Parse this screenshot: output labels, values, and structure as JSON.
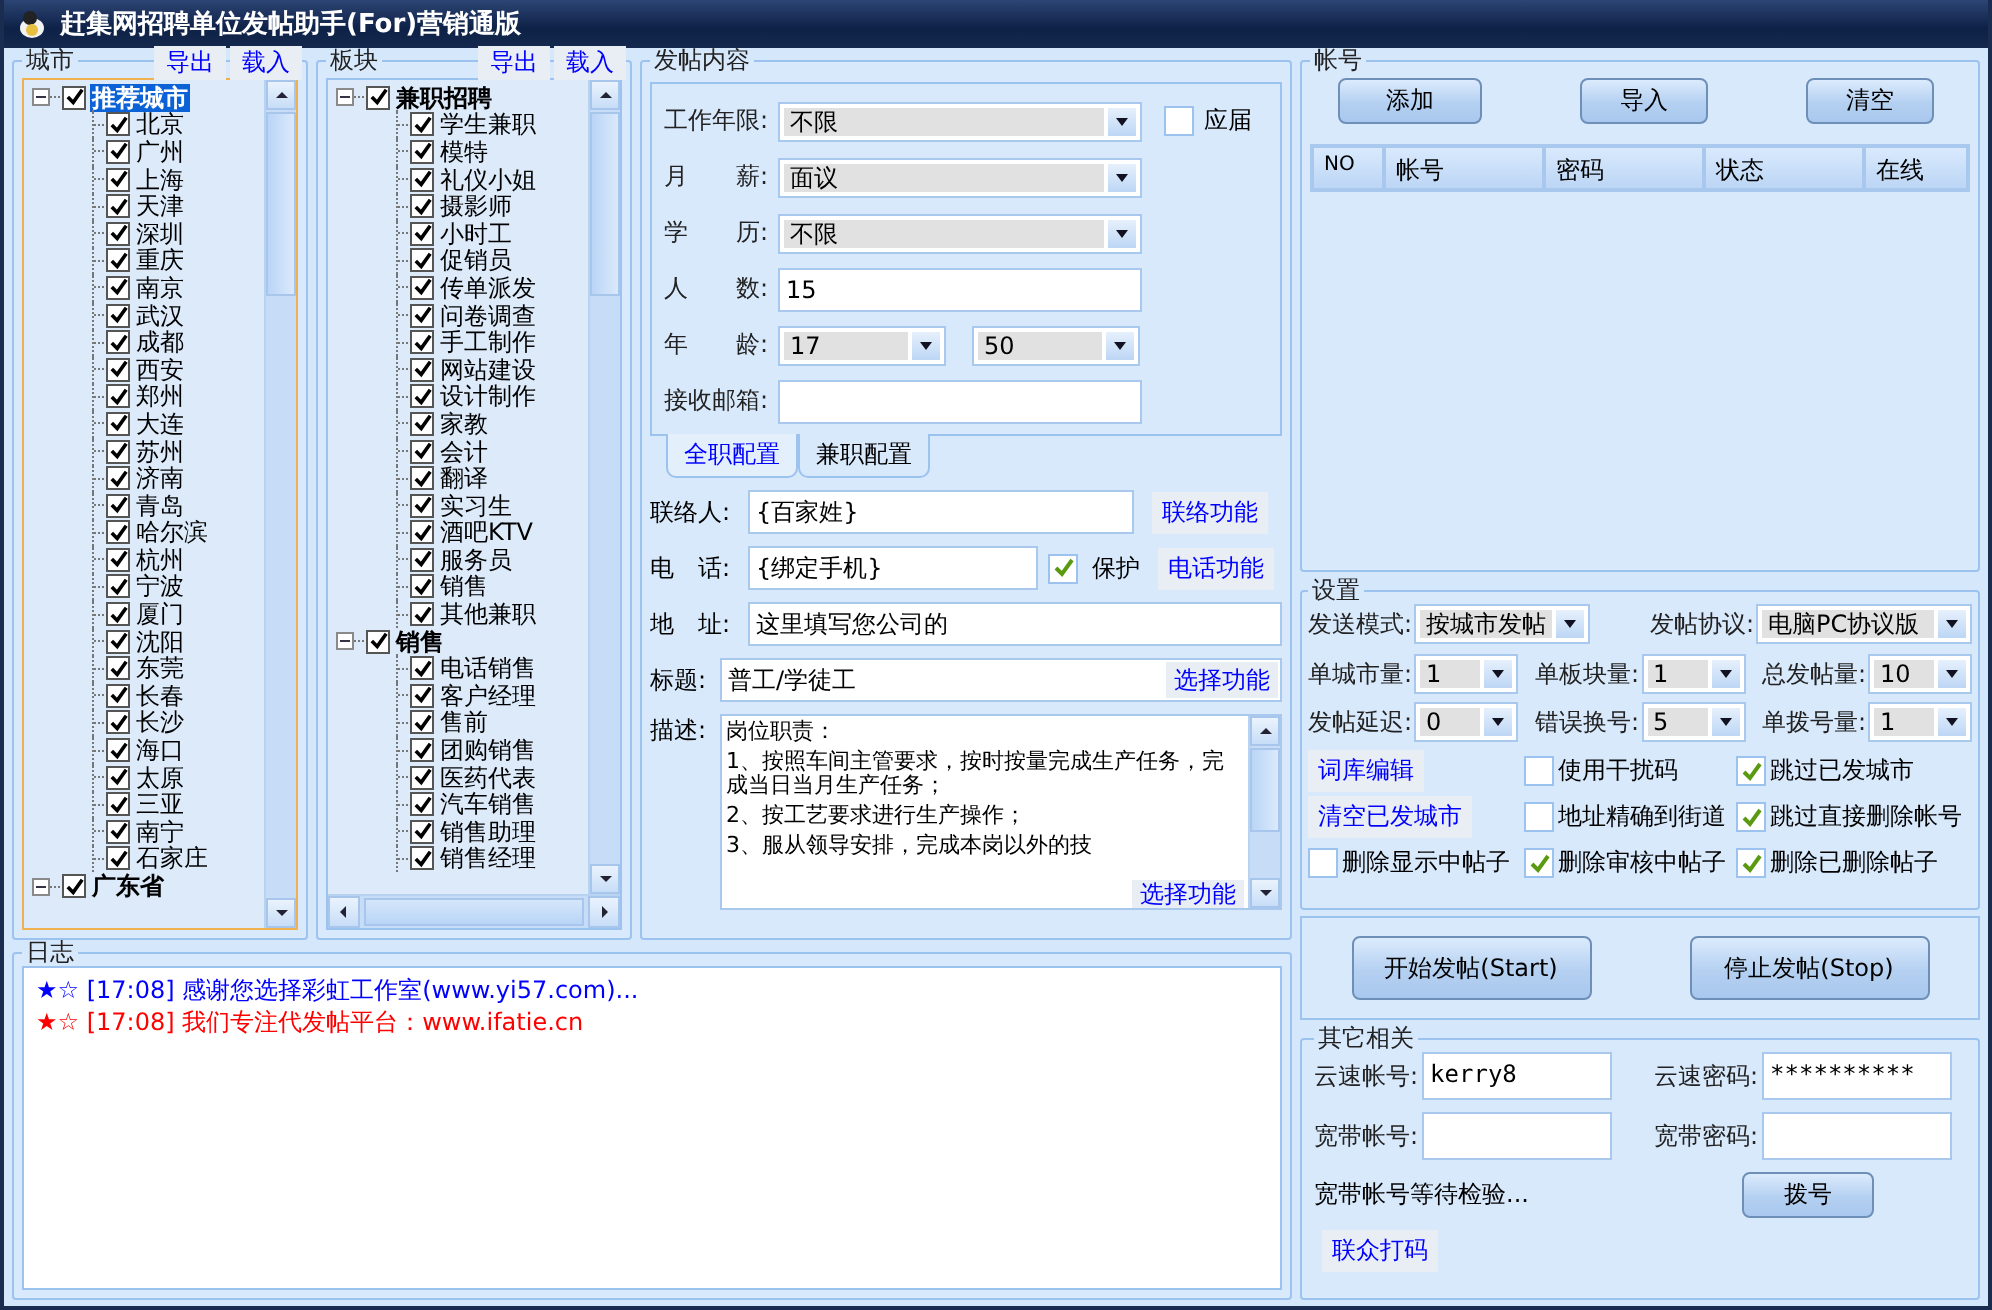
{
  "window": {
    "title": "赶集网招聘单位发帖助手(For)营销通版"
  },
  "city_panel": {
    "title": "城市",
    "buttons": [
      "导出",
      "载入"
    ],
    "items": [
      {
        "label": "推荐城市",
        "checked": true,
        "expanded": true,
        "selected": true,
        "children": [
          {
            "label": "北京",
            "checked": true
          },
          {
            "label": "广州",
            "checked": true
          },
          {
            "label": "上海",
            "checked": true
          },
          {
            "label": "天津",
            "checked": true
          },
          {
            "label": "深圳",
            "checked": true
          },
          {
            "label": "重庆",
            "checked": true
          },
          {
            "label": "南京",
            "checked": true
          },
          {
            "label": "武汉",
            "checked": true
          },
          {
            "label": "成都",
            "checked": true
          },
          {
            "label": "西安",
            "checked": true
          },
          {
            "label": "郑州",
            "checked": true
          },
          {
            "label": "大连",
            "checked": true
          },
          {
            "label": "苏州",
            "checked": true
          },
          {
            "label": "济南",
            "checked": true
          },
          {
            "label": "青岛",
            "checked": true
          },
          {
            "label": "哈尔滨",
            "checked": true
          },
          {
            "label": "杭州",
            "checked": true
          },
          {
            "label": "宁波",
            "checked": true
          },
          {
            "label": "厦门",
            "checked": true
          },
          {
            "label": "沈阳",
            "checked": true
          },
          {
            "label": "东莞",
            "checked": true
          },
          {
            "label": "长春",
            "checked": true
          },
          {
            "label": "长沙",
            "checked": true
          },
          {
            "label": "海口",
            "checked": true
          },
          {
            "label": "太原",
            "checked": true
          },
          {
            "label": "三亚",
            "checked": true
          },
          {
            "label": "南宁",
            "checked": true
          },
          {
            "label": "石家庄",
            "checked": true
          }
        ]
      },
      {
        "label": "广东省",
        "checked": true,
        "expanded": true,
        "selected": false
      }
    ]
  },
  "board_panel": {
    "title": "板块",
    "buttons": [
      "导出",
      "载入"
    ],
    "items": [
      {
        "label": "兼职招聘",
        "checked": true,
        "expanded": true,
        "selected": false,
        "children": [
          {
            "label": "学生兼职",
            "checked": true
          },
          {
            "label": "模特",
            "checked": true
          },
          {
            "label": "礼仪小姐",
            "checked": true
          },
          {
            "label": "摄影师",
            "checked": true
          },
          {
            "label": "小时工",
            "checked": true
          },
          {
            "label": "促销员",
            "checked": true
          },
          {
            "label": "传单派发",
            "checked": true
          },
          {
            "label": "问卷调查",
            "checked": true
          },
          {
            "label": "手工制作",
            "checked": true
          },
          {
            "label": "网站建设",
            "checked": true
          },
          {
            "label": "设计制作",
            "checked": true
          },
          {
            "label": "家教",
            "checked": true
          },
          {
            "label": "会计",
            "checked": true
          },
          {
            "label": "翻译",
            "checked": true
          },
          {
            "label": "实习生",
            "checked": true
          },
          {
            "label": "酒吧KTV",
            "checked": true
          },
          {
            "label": "服务员",
            "checked": true
          },
          {
            "label": "销售",
            "checked": true
          },
          {
            "label": "其他兼职",
            "checked": true
          }
        ]
      },
      {
        "label": "销售",
        "checked": true,
        "expanded": true,
        "selected": false,
        "children": [
          {
            "label": "电话销售",
            "checked": true
          },
          {
            "label": "客户经理",
            "checked": true
          },
          {
            "label": "售前",
            "checked": true
          },
          {
            "label": "团购销售",
            "checked": true
          },
          {
            "label": "医药代表",
            "checked": true
          },
          {
            "label": "汽车销售",
            "checked": true
          },
          {
            "label": "销售助理",
            "checked": true
          },
          {
            "label": "销售经理",
            "checked": true
          }
        ]
      }
    ]
  },
  "post_content": {
    "title": "发帖内容",
    "fields": [
      {
        "kind": "combo",
        "label": "工作年限:",
        "value": "不限",
        "option": {
          "label": "应届",
          "checked": false
        }
      },
      {
        "kind": "combo",
        "label": "月　　薪:",
        "value": "面议"
      },
      {
        "kind": "combo",
        "label": "学　　历:",
        "value": "不限"
      },
      {
        "kind": "text",
        "label": "人　　数:",
        "value": "15"
      },
      {
        "kind": "range",
        "label": "年　　龄:",
        "values": [
          "17",
          "50"
        ]
      },
      {
        "kind": "text",
        "label": "接收邮箱:"
      }
    ],
    "tabs": [
      {
        "label": "全职配置",
        "selected": true
      },
      {
        "label": "兼职配置",
        "selected": false
      }
    ],
    "contact": {
      "label": "联络人:",
      "value": "{百家姓}",
      "button": "联络功能"
    },
    "phone": {
      "label": "电　话:",
      "value": "{绑定手机}",
      "protect": {
        "label": "保护",
        "checked": true
      },
      "button": "电话功能"
    },
    "address": {
      "label": "地　址:",
      "value": "这里填写您公司的"
    },
    "title_field": {
      "label": "标题:",
      "value": "普工/学徒工",
      "button": "选择功能"
    },
    "description": {
      "label": "描述:",
      "lines": [
        "岗位职责：",
        "1、按照车间主管要求，按时按量完成生产任务，完成当日当月生产任务；",
        "2、按工艺要求进行生产操作；",
        "3、服从领导安排，完成本岗以外的技"
      ],
      "button": "选择功能"
    }
  },
  "log": {
    "title": "日志",
    "entries": [
      {
        "text": "★☆ [17:08] 感谢您选择彩虹工作室(www.yi57.com)...",
        "color": "#0000ff"
      },
      {
        "text": "★☆ [17:08] 我们专注代发帖平台：www.ifatie.cn",
        "color": "#ff0000"
      }
    ]
  },
  "accounts": {
    "title": "帐号",
    "buttons": [
      "添加",
      "导入",
      "清空"
    ],
    "columns": [
      "NO",
      "帐号",
      "密码",
      "状态",
      "在线"
    ]
  },
  "settings": {
    "title": "设置",
    "selects": [
      {
        "label": "发送模式:",
        "value": "按城市发帖"
      },
      {
        "label": "发帖协议:",
        "value": "电脑PC协议版"
      },
      {
        "label": "单城市量:",
        "value": "1"
      },
      {
        "label": "单板块量:",
        "value": "1"
      },
      {
        "label": "总发帖量:",
        "value": "10"
      },
      {
        "label": "发帖延迟:",
        "value": "0"
      },
      {
        "label": "错误换号:",
        "value": "5"
      },
      {
        "label": "单拨号量:",
        "value": "1"
      }
    ],
    "links": [
      "词库编辑",
      "清空已发城市"
    ],
    "options": [
      {
        "label": "使用干扰码",
        "checked": false
      },
      {
        "label": "跳过已发城市",
        "checked": true
      },
      {
        "label": "地址精确到街道",
        "checked": false
      },
      {
        "label": "跳过直接删除帐号",
        "checked": true
      },
      {
        "label": "删除显示中帖子",
        "checked": false
      },
      {
        "label": "删除审核中帖子",
        "checked": true
      },
      {
        "label": "删除已删除帖子",
        "checked": true
      }
    ]
  },
  "actions": [
    "开始发帖(Start)",
    "停止发帖(Stop)"
  ],
  "other": {
    "title": "其它相关",
    "fields": [
      {
        "label": "云速帐号:",
        "value": "kerry8"
      },
      {
        "label": "云速密码:",
        "value": "**********"
      },
      {
        "label": "宽带帐号:"
      },
      {
        "label": "宽带密码:"
      }
    ],
    "status": "宽带帐号等待检验...",
    "dial_button": "拨号",
    "captcha_button": "联众打码"
  }
}
